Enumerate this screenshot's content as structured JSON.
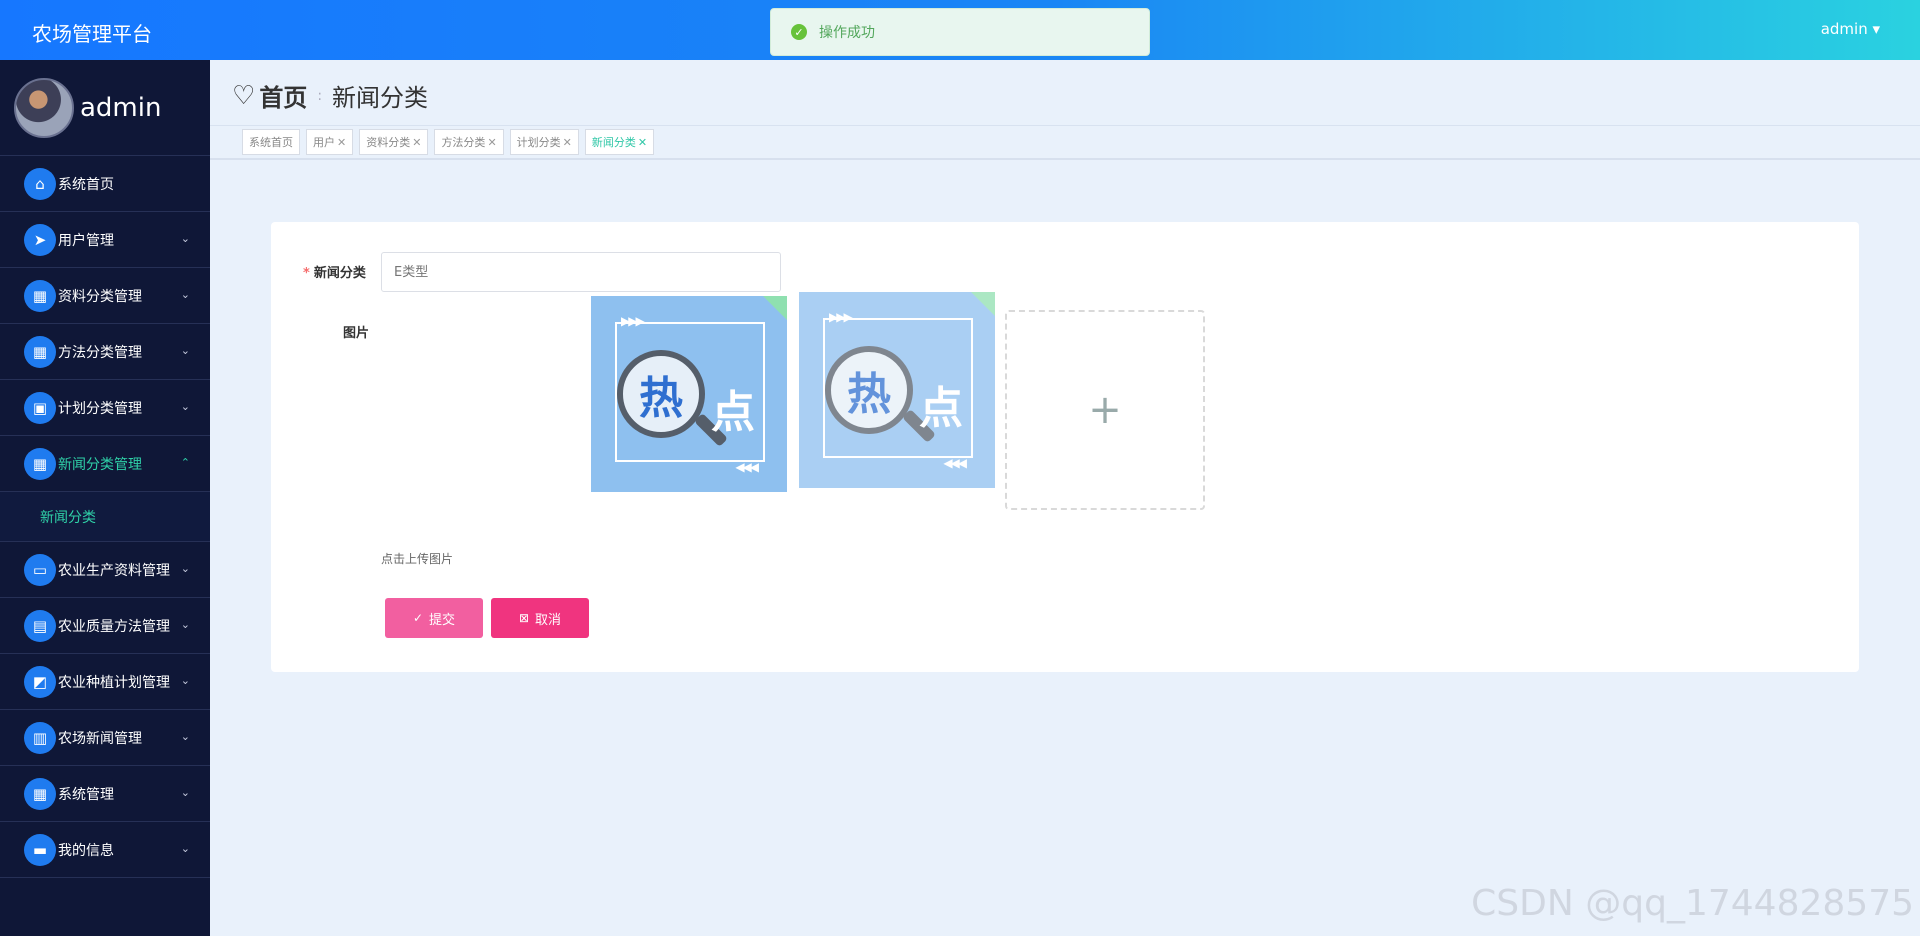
{
  "header": {
    "app_title": "农场管理平台",
    "user": "admin ▾",
    "toast": "操作成功"
  },
  "sidebar": {
    "profile_name": "admin",
    "items": [
      {
        "label": "系统首页",
        "icon": "home-icon",
        "glyph": "⌂"
      },
      {
        "label": "用户管理",
        "icon": "send-icon",
        "glyph": "➤"
      },
      {
        "label": "资料分类管理",
        "icon": "grid-icon",
        "glyph": "▦"
      },
      {
        "label": "方法分类管理",
        "icon": "grid-icon",
        "glyph": "▦"
      },
      {
        "label": "计划分类管理",
        "icon": "clipboard-icon",
        "glyph": "▣"
      },
      {
        "label": "新闻分类管理",
        "icon": "grid-icon",
        "glyph": "▦"
      },
      {
        "label": "农业生产资料管理",
        "icon": "monitor-icon",
        "glyph": "▭"
      },
      {
        "label": "农业质量方法管理",
        "icon": "clipboard-icon",
        "glyph": "▤"
      },
      {
        "label": "农业种植计划管理",
        "icon": "chart-icon",
        "glyph": "◩"
      },
      {
        "label": "农场新闻管理",
        "icon": "book-icon",
        "glyph": "▥"
      },
      {
        "label": "系统管理",
        "icon": "grid-icon",
        "glyph": "▦"
      },
      {
        "label": "我的信息",
        "icon": "card-icon",
        "glyph": "▬"
      }
    ],
    "submenu": {
      "label": "新闻分类"
    }
  },
  "breadcrumb": {
    "home": "首页",
    "current": "新闻分类"
  },
  "tabs": [
    {
      "label": "系统首页",
      "close": ""
    },
    {
      "label": "用户",
      "close": "✕"
    },
    {
      "label": "资料分类",
      "close": "✕"
    },
    {
      "label": "方法分类",
      "close": "✕"
    },
    {
      "label": "计划分类",
      "close": "✕"
    },
    {
      "label": "新闻分类",
      "close": "✕"
    }
  ],
  "form": {
    "field_label": "新闻分类",
    "field_placeholder": "E类型",
    "image_label": "图片",
    "thumb_char1": "热",
    "thumb_char2": "点",
    "upload_plus": "+",
    "hint": "点击上传图片",
    "submit": "提交",
    "cancel": "取消"
  },
  "watermark": "CSDN @qq_1744828575"
}
